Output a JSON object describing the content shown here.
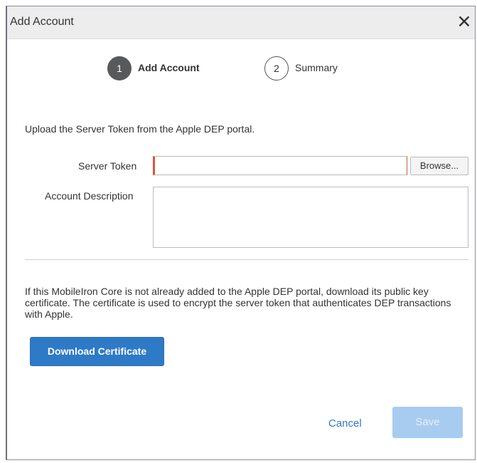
{
  "dialog": {
    "title": "Add Account",
    "close_glyph": "✕"
  },
  "steps": [
    {
      "number": "1",
      "label": "Add Account",
      "active": true
    },
    {
      "number": "2",
      "label": "Summary",
      "active": false
    }
  ],
  "form": {
    "intro": "Upload the Server Token from the Apple DEP portal.",
    "server_token_label": "Server Token",
    "server_token_value": "",
    "browse_label": "Browse...",
    "account_description_label": "Account Description",
    "account_description_value": ""
  },
  "certificate": {
    "info": "If this MobileIron Core is not already added to the Apple DEP portal, download its public key certificate. The certificate is used to encrypt the server token that authenticates DEP transactions with Apple.",
    "download_label": "Download Certificate"
  },
  "footer": {
    "cancel_label": "Cancel",
    "save_label": "Save"
  },
  "colors": {
    "accent": "#2e7ac7",
    "error_border": "#e0543a",
    "active_step": "#58595b",
    "disabled_button": "#a8ccef"
  },
  "icons": {
    "close": "close-icon"
  }
}
